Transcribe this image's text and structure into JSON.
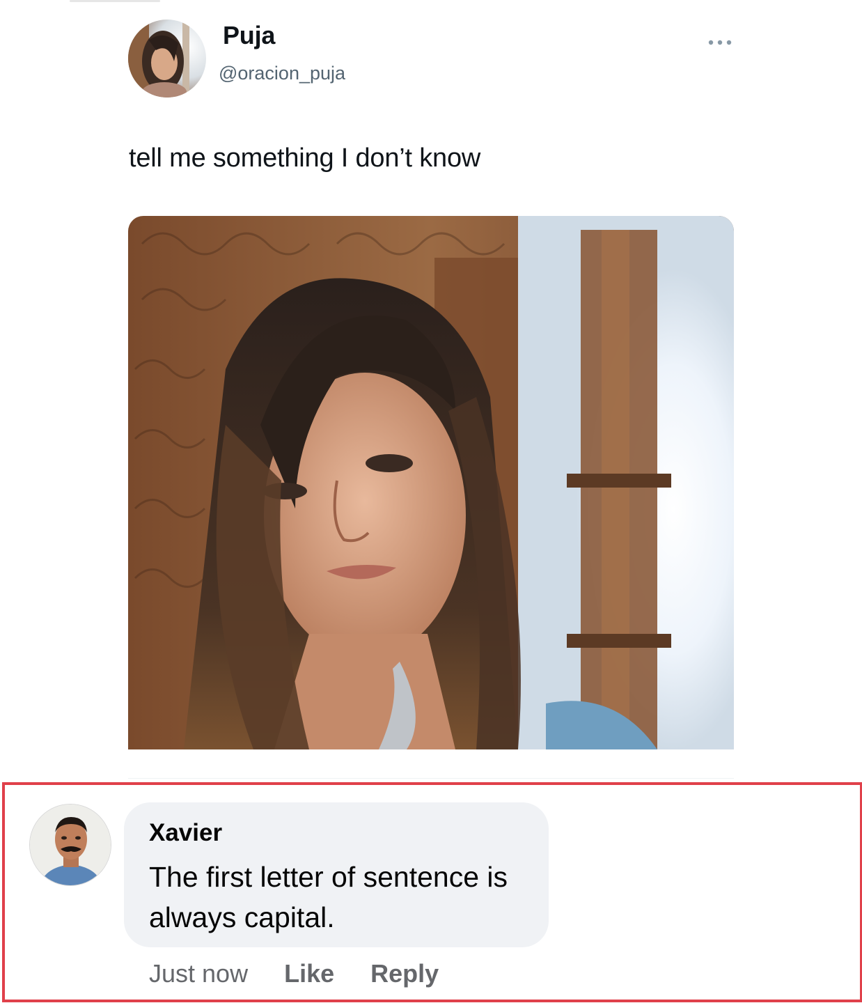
{
  "tweet": {
    "author_name": "Puja",
    "author_handle": "@oracion_puja",
    "more_icon": "more-horizontal-icon",
    "text": "tell me something I don’t know",
    "media_description_icon": "photo"
  },
  "comment": {
    "author_name": "Xavier",
    "text": "The first letter of sentence is always capital.",
    "timestamp": "Just now",
    "like_label": "Like",
    "reply_label": "Reply",
    "highlight_color": "#e0404a"
  }
}
